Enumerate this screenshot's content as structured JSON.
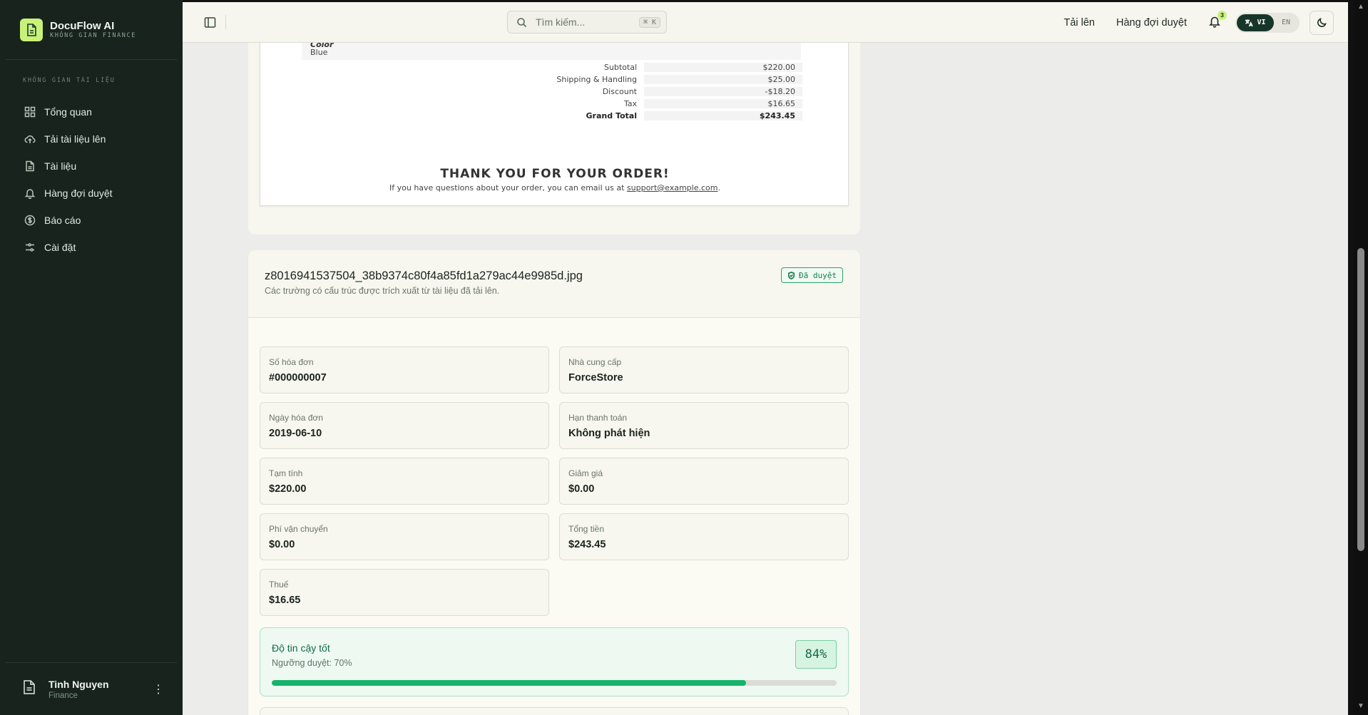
{
  "brand": {
    "name": "DocuFlow AI",
    "subtitle": "KHÔNG GIAN FINANCE"
  },
  "sidebar": {
    "section_label": "KHÔNG GIAN TÀI LIỆU",
    "items": [
      {
        "label": "Tổng quan",
        "icon": "grid-icon"
      },
      {
        "label": "Tải tài liệu lên",
        "icon": "cloud-upload-icon"
      },
      {
        "label": "Tài liệu",
        "icon": "file-icon"
      },
      {
        "label": "Hàng đợi duyệt",
        "icon": "bell-icon"
      },
      {
        "label": "Báo cáo",
        "icon": "dollar-circle-icon"
      },
      {
        "label": "Cài đặt",
        "icon": "sliders-icon"
      }
    ],
    "user": {
      "name": "Tinh Nguyen",
      "role": "Finance"
    }
  },
  "topbar": {
    "search_placeholder": "Tìm kiếm...",
    "search_shortcut": "⌘ K",
    "upload_label": "Tải lên",
    "queue_label": "Hàng đợi duyệt",
    "notification_count": "3",
    "lang_vi": "VI",
    "lang_en": "EN"
  },
  "receipt": {
    "color_label": "Color",
    "color_value": "Blue",
    "totals": [
      {
        "label": "Subtotal",
        "value": "$220.00"
      },
      {
        "label": "Shipping & Handling",
        "value": "$25.00"
      },
      {
        "label": "Discount",
        "value": "-$18.20"
      },
      {
        "label": "Tax",
        "value": "$16.65"
      },
      {
        "label": "Grand Total",
        "value": "$243.45"
      }
    ],
    "thanks": "THANK YOU FOR YOUR ORDER!",
    "thanks_sub_prefix": "If you have questions about your order, you can email us at ",
    "thanks_sub_email": "support@example.com",
    "thanks_sub_suffix": "."
  },
  "details": {
    "file_name": "z8016941537504_38b9374c80f4a85fd1a279ac44e9985d.jpg",
    "subtitle": "Các trường có cấu trúc được trích xuất từ tài liệu đã tải lên.",
    "status": "Đã duyệt",
    "fields": [
      {
        "label": "Số hóa đơn",
        "value": "#000000007"
      },
      {
        "label": "Nhà cung cấp",
        "value": "ForceStore"
      },
      {
        "label": "Ngày hóa đơn",
        "value": "2019-06-10"
      },
      {
        "label": "Hạn thanh toán",
        "value": "Không phát hiện"
      },
      {
        "label": "Tạm tính",
        "value": "$220.00"
      },
      {
        "label": "Giảm giá",
        "value": "$0.00"
      },
      {
        "label": "Phí vận chuyển",
        "value": "$0.00"
      },
      {
        "label": "Tổng tiền",
        "value": "$243.45"
      },
      {
        "label": "Thuế",
        "value": "$16.65"
      }
    ],
    "confidence": {
      "title": "Độ tin cậy tốt",
      "threshold": "Ngưỡng duyệt: 70%",
      "percent_label": "84%",
      "value": 0.84
    }
  },
  "colors": {
    "accent": "#c8f17a",
    "sidebar_bg": "#17231c",
    "success": "#17b26a"
  }
}
